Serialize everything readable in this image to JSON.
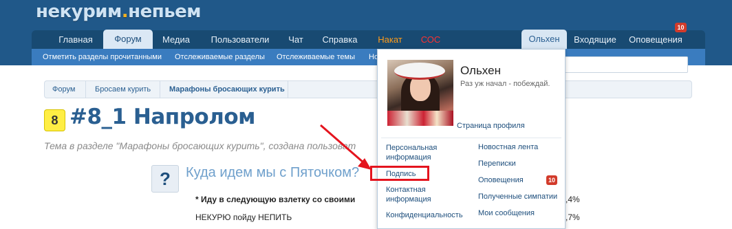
{
  "site": {
    "logo_left": "некурим",
    "logo_right": "непьем",
    "logo_dot": "."
  },
  "nav": {
    "tabs": [
      {
        "label": "Главная"
      },
      {
        "label": "Форум"
      },
      {
        "label": "Медиа"
      },
      {
        "label": "Пользователи"
      },
      {
        "label": "Чат"
      },
      {
        "label": "Справка"
      },
      {
        "label": "Накат"
      },
      {
        "label": "СОС"
      }
    ],
    "user_tab": "Ольхен",
    "inbox": "Входящие",
    "alerts": "Оповещения",
    "alerts_count": "10"
  },
  "subnav": {
    "items": [
      "Отметить разделы прочитанными",
      "Отслеживаемые разделы",
      "Отслеживаемые темы",
      "Но"
    ]
  },
  "breadcrumb": [
    "Форум",
    "Бросаем курить",
    "Марафоны бросающих курить"
  ],
  "thread": {
    "prefix": "8",
    "title": "#8_1 Напролом",
    "subtitle": "Тема в разделе \"Марафоны бросающих курить\", создана пользоват"
  },
  "poll": {
    "icon": "?",
    "question": "Куда идем мы с Пяточком?",
    "rows": [
      {
        "text": "* Иду в следующую взлетку со своими",
        "pct": ",4%"
      },
      {
        "text": "НЕКУРЮ пойду НЕПИТЬ",
        "pct": ",7%"
      }
    ]
  },
  "user_menu": {
    "name": "Ольхен",
    "status": "Раз уж начал - побеждай.",
    "profile_link": "Страница профиля",
    "left_items": [
      "Персональная информация",
      "Подпись",
      "Контактная информация",
      "Конфиденциальность"
    ],
    "right_items": [
      "Новостная лента",
      "Переписки",
      "Оповещения",
      "Полученные симпатии",
      "Мои сообщения"
    ],
    "alerts_count": "10"
  },
  "colors": {
    "header": "#205889",
    "accent": "#2a5f91",
    "annotation": "#e4141e"
  }
}
